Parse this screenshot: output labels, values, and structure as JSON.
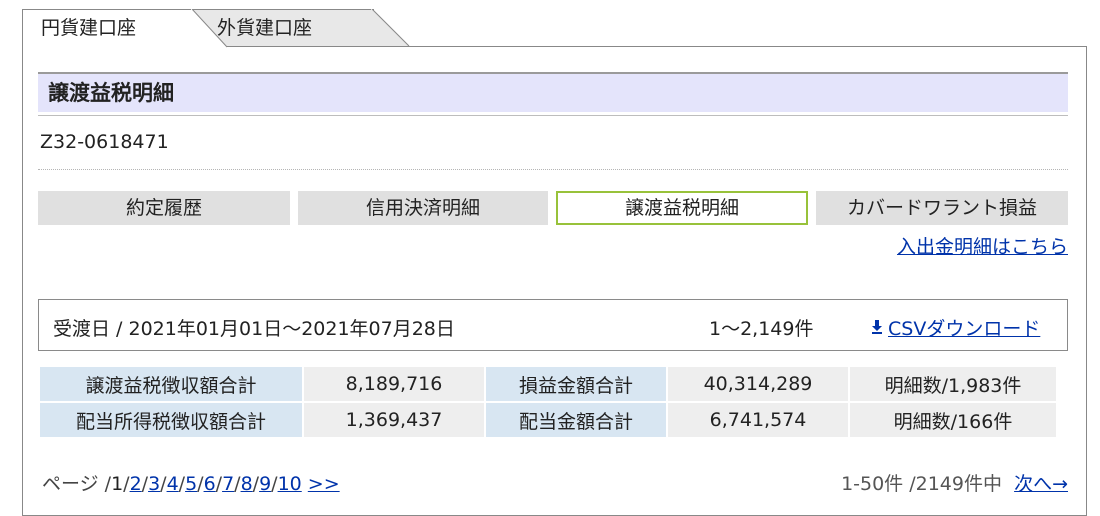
{
  "tabs": [
    {
      "label": "円貨建口座",
      "active": true
    },
    {
      "label": "外貨建口座",
      "active": false
    }
  ],
  "section_title": "譲渡益税明細",
  "account_number": "Z32-0618471",
  "nav": [
    {
      "label": "約定履歴"
    },
    {
      "label": "信用決済明細"
    },
    {
      "label": "譲渡益税明細"
    },
    {
      "label": "カバードワラント損益"
    }
  ],
  "deposit_link": "入出金明細はこちら",
  "filter": {
    "date_range": "受渡日 / 2021年01月01日～2021年07月28日",
    "count": "1～2,149件",
    "csv_label": "CSVダウンロード",
    "csv_icon": "download-arrow-icon"
  },
  "summary": {
    "rows": [
      [
        "譲渡益税徴収額合計",
        "8,189,716",
        "損益金額合計",
        "40,314,289",
        "明細数/1,983件"
      ],
      [
        "配当所得税徴収額合計",
        "1,369,437",
        "配当金額合計",
        "6,741,574",
        "明細数/166件"
      ]
    ]
  },
  "pager": {
    "prefix": "ページ /",
    "current": "1",
    "pages": [
      "2",
      "3",
      "4",
      "5",
      "6",
      "7",
      "8",
      "9",
      "10"
    ],
    "more": ">>",
    "range_text": "1-50件 /2149件中",
    "next": "次へ→"
  },
  "colors": {
    "title_bg": "#e4e4fb",
    "active_nav_border": "#98c23a",
    "label_cell": "#d8e6f2",
    "value_cell": "#eeeeee",
    "link": "#0033aa"
  }
}
